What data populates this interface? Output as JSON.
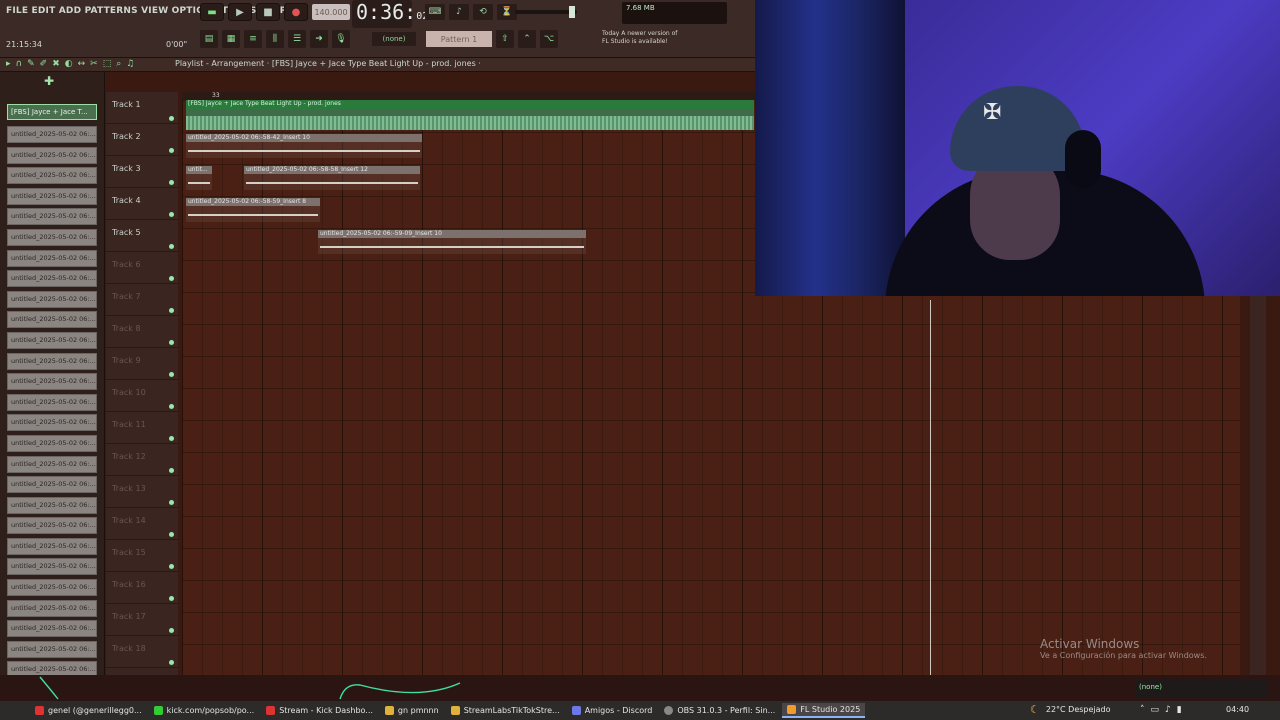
{
  "menu": "FILE  EDIT  ADD  PATTERNS  VIEW  OPTIONS  TOOLS  HELP",
  "clock": "21:15:34",
  "zoom": "0'00\"",
  "tempo": "140.000",
  "time_main": "0:36:",
  "time_sub": "02",
  "cpu_text": "7.68 MB",
  "snap": "(none)",
  "pattern_selector": "Pattern 1",
  "news": {
    "line1": "Today  A newer version of",
    "line2": "FL Studio is available!"
  },
  "playlist_title": "Playlist - Arrangement · [FBS] Jayce + Jace Type Beat Light Up - prod. jones ·",
  "picker": {
    "active": "[FBS] Jayce + Jace T...",
    "items": [
      "untitled_2025-05-02 06:...",
      "untitled_2025-05-02 06:...",
      "untitled_2025-05-02 06:...",
      "untitled_2025-05-02 06:...",
      "untitled_2025-05-02 06:...",
      "untitled_2025-05-02 06:...",
      "untitled_2025-05-02 06:...",
      "untitled_2025-05-02 06:...",
      "untitled_2025-05-02 06:...",
      "untitled_2025-05-02 06:...",
      "untitled_2025-05-02 06:...",
      "untitled_2025-05-02 06:...",
      "untitled_2025-05-02 06:...",
      "untitled_2025-05-02 06:...",
      "untitled_2025-05-02 06:...",
      "untitled_2025-05-02 06:...",
      "untitled_2025-05-02 06:...",
      "untitled_2025-05-02 06:...",
      "untitled_2025-05-02 06:...",
      "untitled_2025-05-02 06:...",
      "untitled_2025-05-02 06:...",
      "untitled_2025-05-02 06:...",
      "untitled_2025-05-02 06:...",
      "untitled_2025-05-02 06:...",
      "untitled_2025-05-02 06:...",
      "untitled_2025-05-02 06:...",
      "untitled_2025-05-02 06:...",
      "untitled_2025-05-02 06:..."
    ]
  },
  "tracks": [
    "Track 1",
    "Track 2",
    "Track 3",
    "Track 4",
    "Track 5",
    "Track 6",
    "Track 7",
    "Track 8",
    "Track 9",
    "Track 10",
    "Track 11",
    "Track 12",
    "Track 13",
    "Track 14",
    "Track 15",
    "Track 16",
    "Track 17",
    "Track 18"
  ],
  "ruler_marks": [
    "33",
    "",
    "",
    "",
    "",
    "",
    ""
  ],
  "clips": {
    "main": "[FBS] Jayce + Jace Type Beat Light Up - prod. jones",
    "t2": "untitled_2025-05-02 06:-58-42_Insert 10",
    "t3a": "untit...",
    "t3b": "untitled_2025-05-02 06:-58-58_Insert 12",
    "t4": "untitled_2025-05-02 06:-58-59_Insert 8",
    "t5": "untitled_2025-05-02 06:-59-09_Insert 10"
  },
  "watermark": {
    "title": "Activar Windows",
    "sub": "Ve a Configuración para activar Windows."
  },
  "taskbar": {
    "tray_top": "(none)",
    "tasks": [
      "genel (@generillegg0...",
      "kick.com/popsob/po...",
      "Stream - Kick Dashbo...",
      "gn pmnnn",
      "StreamLabsTikTokStre...",
      "Amigos - Discord",
      "OBS 31.0.3 - Perfil: Sin...",
      "FL Studio 2025"
    ],
    "weather": "22°C  Despejado",
    "time": "04:40"
  },
  "colors": {
    "accent_green": "#8fe09a",
    "playlist_bg": "#4a2014"
  }
}
